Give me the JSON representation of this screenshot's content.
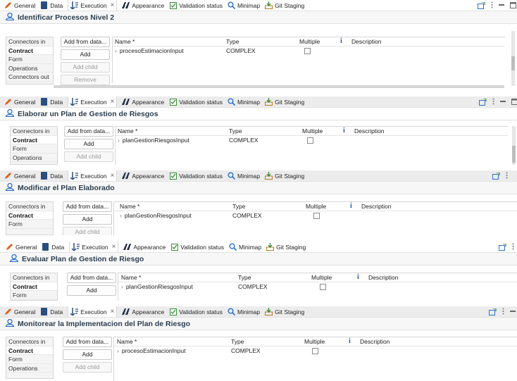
{
  "tabs": [
    {
      "label": "General",
      "icon": "pencil-icon"
    },
    {
      "label": "Data",
      "icon": "database-icon"
    },
    {
      "label": "Execution",
      "icon": "execution-icon"
    },
    {
      "label": "Appearance",
      "icon": "appearance-icon"
    },
    {
      "label": "Validation status",
      "icon": "checkbox-icon"
    },
    {
      "label": "Minimap",
      "icon": "search-icon"
    },
    {
      "label": "Git Staging",
      "icon": "git-staging-icon"
    }
  ],
  "active_tab": "Execution",
  "columns": {
    "name": "Name *",
    "type": "Type",
    "multiple": "Multiple",
    "info_icon_glyph": "i",
    "description": "Description"
  },
  "buttons": {
    "add_from_data": "Add from data...",
    "add": "Add",
    "add_child": "Add child",
    "remove": "Remove"
  },
  "sidebar_labels": {
    "connectors_in": "Connectors in",
    "contract": "Contract",
    "form": "Form",
    "operations": "Operations",
    "connectors_out": "Connectors out"
  },
  "panels": [
    {
      "title": "Identificar Procesos Nivel 2",
      "row": {
        "name": "procesoEstimacionInput",
        "type": "COMPLEX",
        "multiple": false
      }
    },
    {
      "title": "Elaborar un Plan de Gestion de Riesgos",
      "row": {
        "name": "planGestionRiesgosInput",
        "type": "COMPLEX",
        "multiple": false
      }
    },
    {
      "title": "Modificar el Plan Elaborado",
      "row": {
        "name": "planGestionRiesgosInput",
        "type": "COMPLEX",
        "multiple": false
      }
    },
    {
      "title": "Evaluar Plan de Gestion de Riesgo",
      "row": {
        "name": "planGestionRiesgosInput",
        "type": "COMPLEX",
        "multiple": false
      }
    },
    {
      "title": "Monitorear la Implementacion del Plan de Riesgo",
      "row": {
        "name": "procesoEstimacionInput",
        "type": "COMPLEX",
        "multiple": false
      }
    }
  ],
  "colors": {
    "title_text": "#2b3e50",
    "pencil_icon": "#e0601c",
    "database_icon": "#2a4f7e",
    "info_icon": "#2a5db0",
    "minimap_icon": "#2a6fc9",
    "validation_icon": "#3a8a3a"
  }
}
